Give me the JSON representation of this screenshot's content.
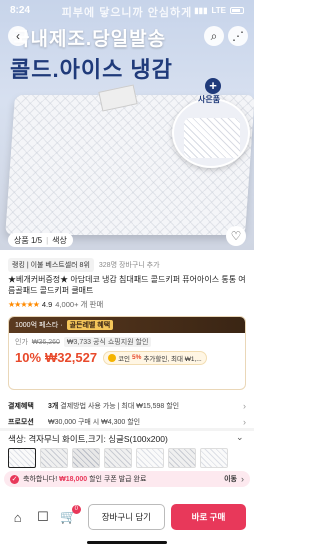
{
  "status_bar": {
    "time": "8:24",
    "network": "LTE",
    "battery_icon": "battery-icon"
  },
  "hero": {
    "headline_top": "피부에 닿으니까 안심하게",
    "headline_main": "국내제조.당일발송",
    "headline_sub": "콜드.아이스 냉감",
    "sample_label": "사은품",
    "counter_tab": "상품 1/5",
    "counter_color": "색상"
  },
  "ranking": {
    "badge": "랭킹 | 이불 베스트셀러 8위",
    "cart_count": "328명 장바구니 추가"
  },
  "product_title": "★베개커버증정★ 아담데코 냉감 침대패드 콜드키퍼 퓨어아이스 통통 여름골패드 콜드키퍼 쿨매트",
  "rating": {
    "stars": "★★★★★",
    "score": "4.9",
    "reviews": "4,000+ 개 판매"
  },
  "promo": {
    "head_prefix": "1000억 페스타 ·",
    "head_highlight": "골든레벨 혜택",
    "list_label": "인가",
    "list_price": "₩36,260",
    "badge": "₩3,733 공식 쇼핑지원 할인",
    "discount": "10%",
    "price": "₩32,527",
    "coin_text": "코인",
    "coin_rate": "5%",
    "coin_rest": "추가할인, 최대 ₩1,..."
  },
  "benefits": [
    {
      "key": "결제혜택",
      "value_bold": "3개",
      "value": " 결제방법 사용 가능 | 최대 ₩15,598 할인"
    },
    {
      "key": "프로모션",
      "value_bold": "",
      "value": "₩30,000 구매 시 ₩4,300 할인"
    }
  ],
  "option": {
    "label": "색상: 격자무늬 화이트,크기: 싱글S(100x200)"
  },
  "congrats": {
    "prefix": "축하합니다!",
    "amount": "₩18,000",
    "suffix": " 할인 쿠폰 발급 완료",
    "action": "이동"
  },
  "bottom": {
    "cart_badge": "0",
    "cart_button": "장바구니 담기",
    "buy_button": "바로 구매"
  },
  "colors": {
    "accent": "#e8385a",
    "price": "#e8492b",
    "hero_text": "#1f3a7a",
    "star": "#ff8a00"
  }
}
